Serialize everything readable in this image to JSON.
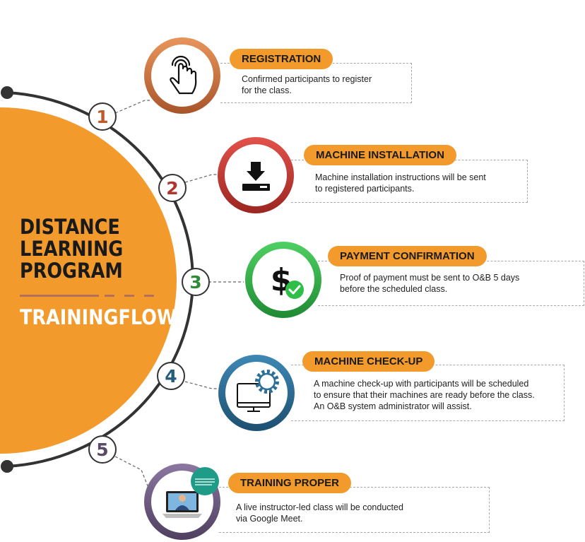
{
  "title": {
    "lines": [
      "DISTANCE",
      "LEARNING",
      "PROGRAM"
    ],
    "subtitle": "TRAININGFLOW"
  },
  "colors": {
    "accent": "#f39a2d",
    "step1": "#d9773a",
    "step2": "#d23a33",
    "step3": "#34b24a",
    "step4": "#2d6f96",
    "step5": "#6b567e"
  },
  "steps": [
    {
      "number": "1",
      "title": "REGISTRATION",
      "desc_lines": [
        "Confirmed participants to register",
        "for the class."
      ],
      "icon": "touch-hand-icon",
      "number_color": "#c05a2e"
    },
    {
      "number": "2",
      "title": "MACHINE INSTALLATION",
      "desc_lines": [
        "Machine installation instructions will be sent",
        "to registered participants."
      ],
      "icon": "download-icon",
      "number_color": "#b2342f"
    },
    {
      "number": "3",
      "title": "PAYMENT CONFIRMATION",
      "desc_lines": [
        "Proof of payment must be sent to O&B 5 days",
        "before the scheduled class."
      ],
      "icon": "dollar-check-icon",
      "number_color": "#2f8a3a"
    },
    {
      "number": "4",
      "title": "MACHINE CHECK-UP",
      "desc_lines": [
        "A machine check-up with participants will be scheduled",
        "to ensure that their machines are ready before the class.",
        "An O&B system administrator will assist."
      ],
      "icon": "monitor-gear-icon",
      "number_color": "#245c7c"
    },
    {
      "number": "5",
      "title": "TRAINING PROPER",
      "desc_lines": [
        "A live instructor-led class will be conducted",
        "via Google Meet."
      ],
      "icon": "video-call-laptop-icon",
      "number_color": "#5a4a6a"
    }
  ]
}
